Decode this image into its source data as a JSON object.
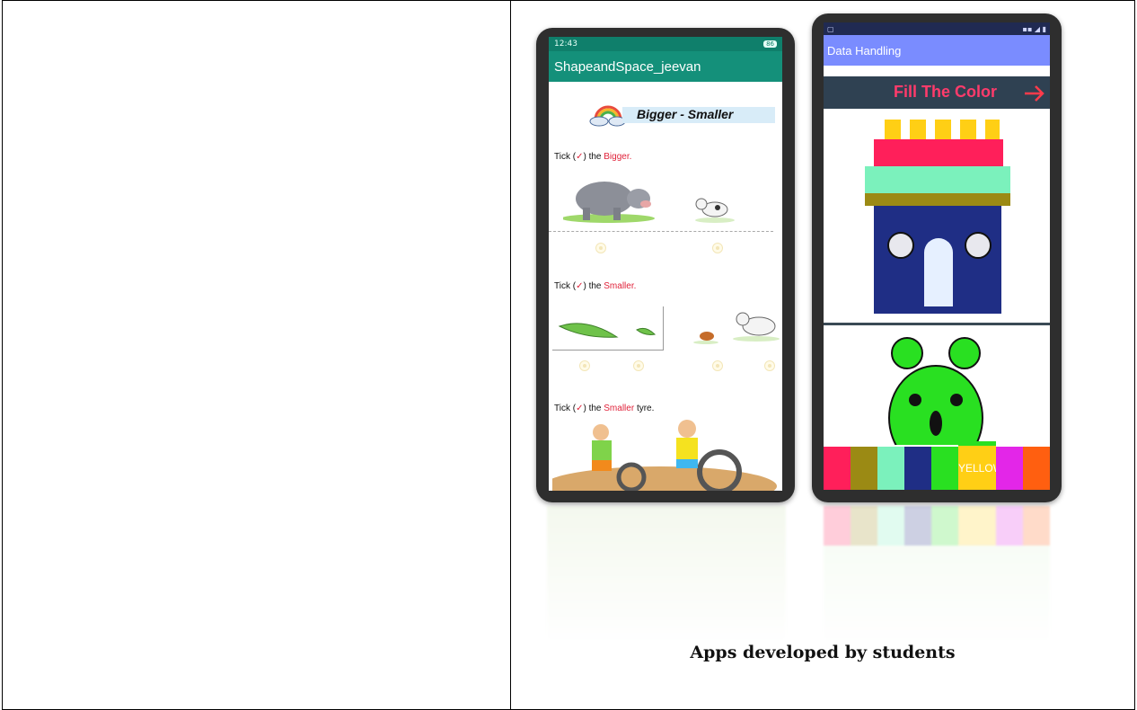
{
  "phone_left": {
    "status_time": "12:43",
    "battery": "86",
    "app_title": "ShapeandSpace_jeevan",
    "section_title": "Bigger - Smaller",
    "q1_prefix": "Tick (",
    "q1_mid": ") the ",
    "q1_word": "Bigger",
    "q1_end": ".",
    "q2_word": "Smaller",
    "q2_end": ".",
    "q3_word": "Smaller",
    "q3_end": " tyre."
  },
  "phone_right": {
    "app_title": "Data Handling",
    "fill_title": "Fill The Color",
    "selected_color_label": "YELLOW",
    "palette": [
      "#ff1f5a",
      "#9b8a14",
      "#7bf1bc",
      "#1f2e85",
      "#29e021",
      "#ffcf15",
      "#e326e8",
      "#ff5f10"
    ]
  },
  "caption": "Apps developed by students"
}
